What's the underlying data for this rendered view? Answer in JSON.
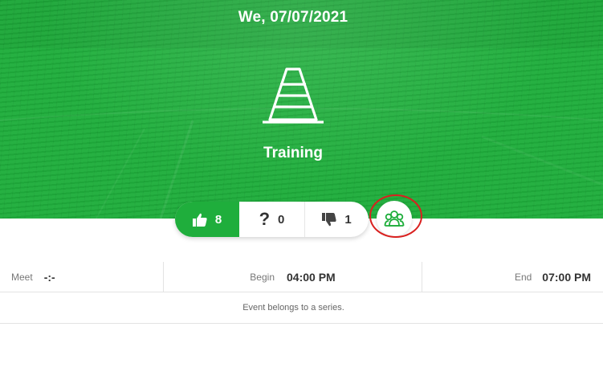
{
  "header": {
    "date": "We, 07/07/2021",
    "event_type": "Training",
    "event_icon": "traffic-cone-icon",
    "background_color": "#1fae3c"
  },
  "rsvp": {
    "yes": {
      "icon": "thumbs-up-icon",
      "count": "8"
    },
    "maybe": {
      "icon": "question-mark-icon",
      "count": "0"
    },
    "no": {
      "icon": "thumbs-down-icon",
      "count": "1"
    },
    "series_button_icon": "group-icon",
    "highlight_color": "#d9201f"
  },
  "times": {
    "meet_label": "Meet",
    "meet_value": "-:-",
    "begin_label": "Begin",
    "begin_value": "04:00 PM",
    "end_label": "End",
    "end_value": "07:00 PM"
  },
  "series_note": "Event belongs to a series."
}
